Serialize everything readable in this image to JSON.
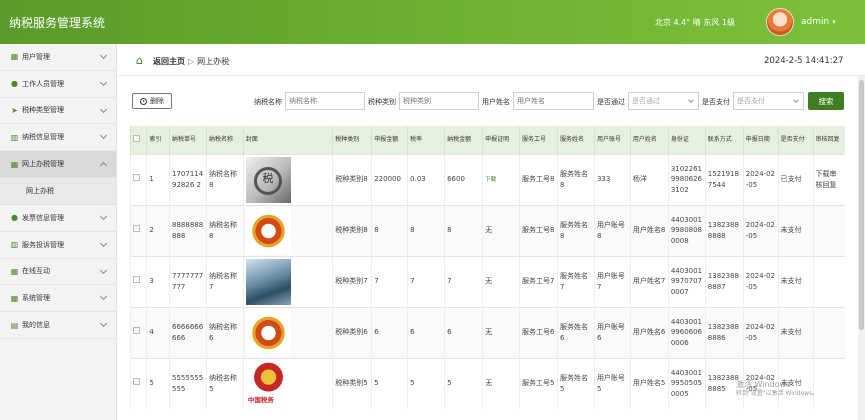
{
  "app": {
    "title": "纳税服务管理系统"
  },
  "header": {
    "weather": "北京 4.4° 晴 东风 1级",
    "username": "admin",
    "caret": "▾"
  },
  "sidebar": {
    "items": [
      {
        "label": "用户管理",
        "icon": "grid-icon"
      },
      {
        "label": "工作人员管理",
        "icon": "user-icon"
      },
      {
        "label": "税种类型管理",
        "icon": "send-icon"
      },
      {
        "label": "纳税信息管理",
        "icon": "chart-icon"
      },
      {
        "label": "网上办税管理",
        "icon": "grid-icon",
        "active": true
      },
      {
        "label": "发票信息管理",
        "icon": "user-icon"
      },
      {
        "label": "服务投诉管理",
        "icon": "chart-icon"
      },
      {
        "label": "在线互动",
        "icon": "grid-icon"
      },
      {
        "label": "系统管理",
        "icon": "grid-icon"
      },
      {
        "label": "我的信息",
        "icon": "card-icon"
      }
    ],
    "sub_item": "网上办税"
  },
  "breadcrumb": {
    "home": "返回主页",
    "separator": "▷",
    "current": "网上办税"
  },
  "datetime": "2024-2-5 14:41:27",
  "toolbar": {
    "delete_label": "删除",
    "search_label": "搜索"
  },
  "filters": {
    "tax_name": {
      "label": "纳税名称",
      "placeholder": "纳税名称"
    },
    "tax_type": {
      "label": "税种类别",
      "placeholder": "税种类别"
    },
    "user_name": {
      "label": "用户姓名",
      "placeholder": "用户姓名"
    },
    "approved": {
      "label": "是否通过",
      "placeholder": "是否通过"
    },
    "paid": {
      "label": "是否支付",
      "placeholder": "是否支付"
    }
  },
  "table": {
    "headers": [
      "索引",
      "纳税单号",
      "纳税名称",
      "封面",
      "税种类别",
      "申报金额",
      "税率",
      "纳税金额",
      "申报证明",
      "服务工号",
      "服务姓名",
      "用户账号",
      "用户姓名",
      "身份证",
      "联系方式",
      "申报日期",
      "是否支付",
      "审核回复"
    ],
    "rows": [
      {
        "idx": "1",
        "no": "170711492826 2",
        "name": "纳税名称8",
        "type": "税种类别8",
        "amount": "220000",
        "rate": "0.03",
        "tax": "6600",
        "proof": "下载",
        "staff_no": "服务工号8",
        "staff_name": "服务姓名8",
        "account": "333",
        "user": "杨洋",
        "id_card": "310226199806263102",
        "phone": "15219187544",
        "date": "2024-02-05",
        "paid": "已支付",
        "reply": "下载审核回复"
      },
      {
        "idx": "2",
        "no": "8888888888",
        "name": "纳税名称8",
        "type": "税种类别8",
        "amount": "8",
        "rate": "8",
        "tax": "8",
        "proof": "无",
        "staff_no": "服务工号8",
        "staff_name": "服务姓名8",
        "account": "用户账号8",
        "user": "用户姓名8",
        "id_card": "440300199808080008",
        "phone": "13823888888",
        "date": "2024-02-05",
        "paid": "未支付",
        "reply": ""
      },
      {
        "idx": "3",
        "no": "7777777777",
        "name": "纳税名称7",
        "type": "税种类别7",
        "amount": "7",
        "rate": "7",
        "tax": "7",
        "proof": "无",
        "staff_no": "服务工号7",
        "staff_name": "服务姓名7",
        "account": "用户账号7",
        "user": "用户姓名7",
        "id_card": "440300199707070007",
        "phone": "13823888887",
        "date": "2024-02-05",
        "paid": "未支付",
        "reply": ""
      },
      {
        "idx": "4",
        "no": "6666666666",
        "name": "纳税名称6",
        "type": "税种类别6",
        "amount": "6",
        "rate": "6",
        "tax": "6",
        "proof": "无",
        "staff_no": "服务工号6",
        "staff_name": "服务姓名6",
        "account": "用户账号6",
        "user": "用户姓名6",
        "id_card": "440300199606060006",
        "phone": "13823888886",
        "date": "2024-02-05",
        "paid": "未支付",
        "reply": ""
      },
      {
        "idx": "5",
        "no": "5555555555",
        "name": "纳税名称5",
        "type": "税种类别5",
        "amount": "5",
        "rate": "5",
        "tax": "5",
        "proof": "无",
        "staff_no": "服务工号5",
        "staff_name": "服务姓名5",
        "account": "用户账号5",
        "user": "用户姓名5",
        "id_card": "440300199505050005",
        "phone": "13823888885",
        "date": "2024-02-05",
        "paid": "未支付",
        "reply": ""
      }
    ]
  },
  "watermark": {
    "line1": "激活 Windows",
    "line2": "转到\"设置\"以激活 Windows。"
  },
  "colors": {
    "brand": "#6fb532",
    "button": "#3f7f22",
    "header_row": "#e6f0e0"
  }
}
